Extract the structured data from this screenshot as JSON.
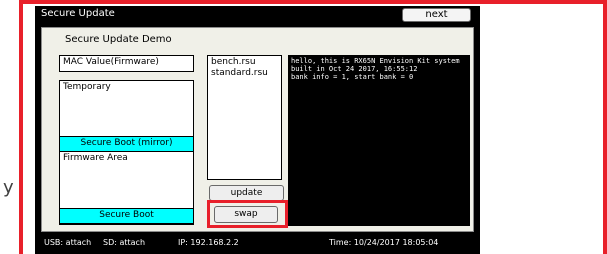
{
  "window": {
    "title": "Secure Update",
    "next_label": "next"
  },
  "panel": {
    "title": "Secure Update Demo",
    "mac_label": "MAC Value(Firmware)",
    "temporary_label": "Temporary",
    "mirror_label": "Secure Boot (mirror)",
    "firmware_label": "Firmware Area",
    "secure_boot_label": "Secure Boot"
  },
  "files": [
    "bench.rsu",
    "standard.rsu"
  ],
  "buttons": {
    "update_label": "update",
    "swap_label": "swap"
  },
  "console": {
    "lines": [
      "hello, this is RX65N Envision Kit system",
      "built in Oct 24 2017, 16:55:12",
      "bank info = 1, start bank = 0"
    ]
  },
  "status": {
    "usb": "USB: attach",
    "sd": "SD: attach",
    "ip": "IP: 192.168.2.2",
    "time": "Time: 10/24/2017 18:05:04"
  },
  "side_text": "y",
  "colors": {
    "highlight": "#e8202a",
    "cyan": "#00ffff",
    "screen_bg": "#000000",
    "panel_bg": "#f0f0e8"
  }
}
